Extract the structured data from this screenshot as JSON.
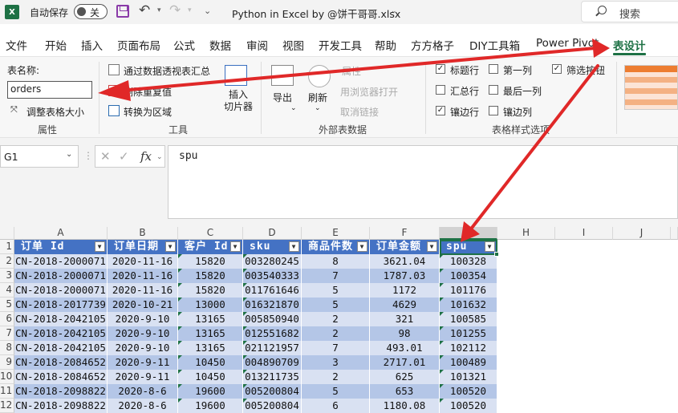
{
  "titlebar": {
    "logo": "X",
    "autosave_label": "自动保存",
    "autosave_state": "关",
    "filename": "Python in Excel by @饼干哥哥.xlsx",
    "search_placeholder": "搜索"
  },
  "menu": {
    "items": [
      "文件",
      "开始",
      "插入",
      "页面布局",
      "公式",
      "数据",
      "审阅",
      "视图",
      "开发工具",
      "帮助",
      "方方格子",
      "DIY工具箱",
      "Power Pivot",
      "表设计"
    ],
    "active": "表设计"
  },
  "ribbon": {
    "properties": {
      "table_name_label": "表名称:",
      "table_name_value": "orders",
      "resize_label": "调整表格大小",
      "group_label": "属性"
    },
    "tools": {
      "pivot_label": "通过数据透视表汇总",
      "remove_dup_label": "删除重复值",
      "convert_label": "转换为区域",
      "slicer_label": "插入\n切片器",
      "group_label": "工具"
    },
    "external": {
      "export_label": "导出",
      "refresh_label": "刷新",
      "properties_label": "属性",
      "open_browser_label": "用浏览器打开",
      "unlink_label": "取消链接",
      "group_label": "外部表数据"
    },
    "style_options": {
      "header_row": "标题行",
      "first_col": "第一列",
      "filter_btn": "筛选按钮",
      "total_row": "汇总行",
      "last_col": "最后一列",
      "banded_rows": "镶边行",
      "banded_cols": "镶边列",
      "group_label": "表格样式选项"
    }
  },
  "formula_bar": {
    "name_box": "G1",
    "cancel": "✕",
    "confirm": "✓",
    "fx": "fx",
    "value": "spu"
  },
  "grid": {
    "columns": [
      "A",
      "B",
      "C",
      "D",
      "E",
      "F",
      "G",
      "H",
      "I",
      "J"
    ],
    "row_numbers": [
      "1",
      "2",
      "3",
      "4",
      "5",
      "6",
      "7",
      "8",
      "9",
      "10",
      "11",
      "12"
    ],
    "table_headers": [
      "订单 Id",
      "订单日期",
      "客户 Id",
      "sku",
      "商品件数",
      "订单金额",
      "spu"
    ],
    "rows": [
      [
        "CN-2018-2000071",
        "2020-11-16",
        "15820",
        "003280245",
        "8",
        "3621.04",
        "100328"
      ],
      [
        "CN-2018-2000071",
        "2020-11-16",
        "15820",
        "003540333",
        "7",
        "1787.03",
        "100354"
      ],
      [
        "CN-2018-2000071",
        "2020-11-16",
        "15820",
        "011761646",
        "5",
        "1172",
        "101176"
      ],
      [
        "CN-2018-2017739",
        "2020-10-21",
        "13000",
        "016321870",
        "5",
        "4629",
        "101632"
      ],
      [
        "CN-2018-2042105",
        "2020-9-10",
        "13165",
        "005850940",
        "2",
        "321",
        "100585"
      ],
      [
        "CN-2018-2042105",
        "2020-9-10",
        "13165",
        "012551682",
        "2",
        "98",
        "101255"
      ],
      [
        "CN-2018-2042105",
        "2020-9-10",
        "13165",
        "021121957",
        "7",
        "493.01",
        "102112"
      ],
      [
        "CN-2018-2084652",
        "2020-9-11",
        "10450",
        "004890709",
        "3",
        "2717.01",
        "100489"
      ],
      [
        "CN-2018-2084652",
        "2020-9-11",
        "10450",
        "013211735",
        "2",
        "625",
        "101321"
      ],
      [
        "CN-2018-2098822",
        "2020-8-6",
        "19600",
        "005200804",
        "5",
        "653",
        "100520"
      ],
      [
        "CN-2018-2098822",
        "2020-8-6",
        "19600",
        "005200804",
        "6",
        "1180.08",
        "100520"
      ]
    ]
  },
  "colors": {
    "accent": "#1e7145",
    "table_header": "#4472c4",
    "band_light": "#d9e1f2",
    "band_dark": "#b4c6e7",
    "annotation_arrow": "#e02828"
  }
}
